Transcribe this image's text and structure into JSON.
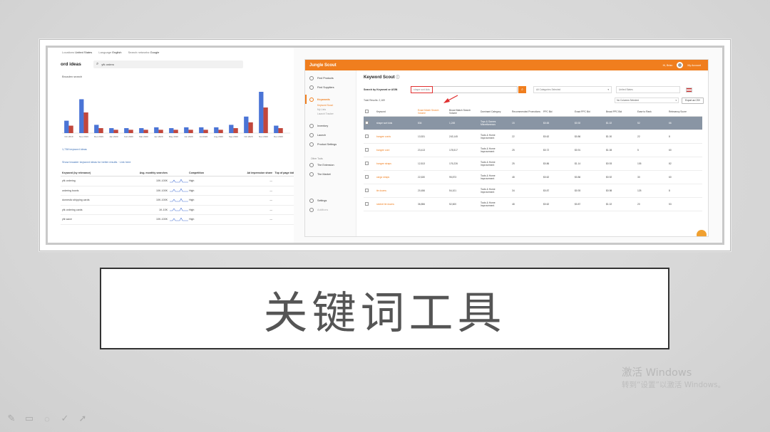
{
  "slide": {
    "title": "关键词工具",
    "watermark_line1": "激活 Windows",
    "watermark_line2": "转到“设置”以激活 Windows。"
  },
  "keyword_planner": {
    "top_bar": [
      {
        "label": "Locations",
        "value": "United States"
      },
      {
        "label": "Language",
        "value": "English"
      },
      {
        "label": "Search networks",
        "value": "Google"
      }
    ],
    "heading": "ord ideas",
    "search_value": "yfk ordero",
    "sub_label": "Broaden search",
    "link1": "1,738 keyword ideas",
    "link2": "Show broader keyword ideas for better results · Link here",
    "columns": [
      "Keyword (by relevance)",
      "Avg. monthly searches",
      "Competition",
      "Ad impression share",
      "Top of page bid"
    ],
    "rows": [
      {
        "keyword": "yfk ordering",
        "searches": "10K-100K",
        "competition": "High"
      },
      {
        "keyword": "ordering bowls",
        "searches": "10K-100K",
        "competition": "High"
      },
      {
        "keyword": "domestic shipping cards",
        "searches": "10K-100K",
        "competition": "High"
      },
      {
        "keyword": "yfk ordering cards",
        "searches": "1K-10K",
        "competition": "High"
      },
      {
        "keyword": "yfk wave",
        "searches": "10K-100K",
        "competition": "High"
      }
    ]
  },
  "chart_data": {
    "type": "bar",
    "categories": [
      "Oct 2019",
      "Nov 2019",
      "Dec 2019",
      "Jan 2020",
      "Feb 2020",
      "Mar 2020",
      "Apr 2020",
      "May 2020",
      "Jun 2020",
      "Jul 2020",
      "Aug 2020",
      "Sep 2020",
      "Oct 2020",
      "Nov 2020",
      "Dec 2020"
    ],
    "series": [
      {
        "values": [
          30,
          82,
          20,
          12,
          12,
          12,
          14,
          12,
          14,
          14,
          14,
          20,
          40,
          100,
          18
        ]
      },
      {
        "values": [
          18,
          50,
          12,
          8,
          8,
          8,
          8,
          8,
          8,
          8,
          8,
          12,
          26,
          62,
          12
        ]
      }
    ],
    "colors": [
      "#4a74d6",
      "#c2473c"
    ],
    "ylim": [
      0,
      100
    ],
    "grid": false
  },
  "jungle_scout": {
    "brand": "Jungle Scout",
    "user": "Hi, Brian",
    "account": "My Account",
    "sidebar": [
      {
        "label": "Find Products",
        "active": false
      },
      {
        "label": "Find Suppliers",
        "active": false
      },
      {
        "label": "Keywords",
        "active": true
      },
      {
        "label": "Inventory",
        "active": false
      },
      {
        "label": "Launch",
        "active": false
      },
      {
        "label": "Product Settings",
        "active": false
      }
    ],
    "sub_items": [
      "Keyword Scout",
      "My Lists",
      "Launch Tracker"
    ],
    "section_label": "Other Tools",
    "tools": [
      "The Extension",
      "The Market"
    ],
    "bottom_items": [
      "Settings",
      "Additions"
    ],
    "page_title": "Keyword Scout",
    "search_label": "Search by Keyword or ASIN",
    "search_value": "shape sort kids",
    "category_select": "All Categories Selected",
    "market_select": "United States",
    "total_results": "Total Results: 2,169",
    "column_options": "No Columns Selected",
    "export_label": "Export as CSV",
    "columns": [
      "Keyword",
      "Exact Match Search Volume",
      "Broad Match Search Volume",
      "Dominant Category",
      "Recommended Promotions",
      "PPC Bid",
      "Exact PPC Bid",
      "Broad PPC Bid",
      "Ease to Rank",
      "Relevancy Score"
    ],
    "rows": [
      {
        "keyword": "shape sort kids",
        "exact": "834",
        "broad": "1,245",
        "category": "Toys & Games Miscellaneous",
        "promo": "15",
        "ppc": "$0.65",
        "exact_bid": "$0.92",
        "broad_bid": "$1.02",
        "ease": "52",
        "rel": "66"
      },
      {
        "keyword": "bungee cords",
        "exact": "13,531",
        "broad": "243,145",
        "category": "Tools & Home Improvement",
        "promo": "22",
        "ppc": "$0.62",
        "exact_bid": "$0.86",
        "broad_bid": "$1.00",
        "ease": "22",
        "rel": "8"
      },
      {
        "keyword": "bungee cord",
        "exact": "23,413",
        "broad": "178,517",
        "category": "Tools & Home Improvement",
        "promo": "25",
        "ppc": "$0.72",
        "exact_bid": "$0.91",
        "broad_bid": "$1.08",
        "ease": "5",
        "rel": "60"
      },
      {
        "keyword": "bungee straps",
        "exact": "12,813",
        "broad": "176,226",
        "category": "Tools & Home Improvement",
        "promo": "25",
        "ppc": "$0.86",
        "exact_bid": "$1.14",
        "broad_bid": "$0.93",
        "ease": "105",
        "rel": "82"
      },
      {
        "keyword": "cargo straps",
        "exact": "22,630",
        "broad": "95,873",
        "category": "Tools & Home Improvement",
        "promo": "48",
        "ppc": "$0.62",
        "exact_bid": "$0.86",
        "broad_bid": "$0.92",
        "ease": "30",
        "rel": "60"
      },
      {
        "keyword": "tie downs",
        "exact": "20,456",
        "broad": "54,101",
        "category": "Tools & Home Improvement",
        "promo": "34",
        "ppc": "$0.87",
        "exact_bid": "$0.93",
        "broad_bid": "$0.98",
        "ease": "125",
        "rel": "8"
      },
      {
        "keyword": "ratchet tie downs",
        "exact": "36,856",
        "broad": "52,600",
        "category": "Tools & Home Improvement",
        "promo": "48",
        "ppc": "$0.62",
        "exact_bid": "$0.87",
        "broad_bid": "$1.02",
        "ease": "20",
        "rel": "53"
      }
    ]
  },
  "toolbar": [
    "pen-icon",
    "layout-icon",
    "chat-icon",
    "check-icon",
    "cursor-icon"
  ]
}
